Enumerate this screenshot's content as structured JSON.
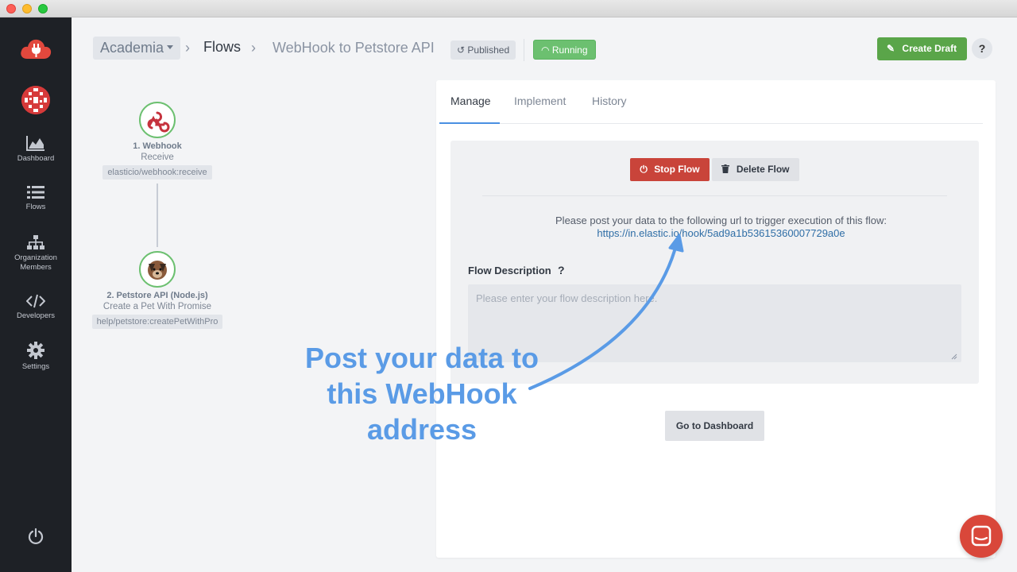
{
  "window": {
    "title": ""
  },
  "sidebar": {
    "items": [
      {
        "label": "Dashboard",
        "icon": "area-chart-icon"
      },
      {
        "label": "Flows",
        "icon": "list-icon"
      },
      {
        "label": "Organization Members",
        "icon": "org-tree-icon"
      },
      {
        "label": "Developers",
        "icon": "code-icon"
      },
      {
        "label": "Settings",
        "icon": "gear-icon"
      }
    ],
    "power_icon": "power-icon"
  },
  "header": {
    "org": "Academia",
    "breadcrumb_flows": "Flows",
    "flow_name": "WebHook to Petstore API",
    "published_label": "Published",
    "running_label": "Running",
    "create_draft_label": "Create Draft",
    "help_label": "?"
  },
  "flow": {
    "steps": [
      {
        "title": "1. Webhook",
        "subtitle": "Receive",
        "tag": "elasticio/webhook:receive"
      },
      {
        "title": "2. Petstore API (Node.js)",
        "subtitle": "Create a Pet With Promise",
        "tag": "help/petstore:createPetWithPro"
      }
    ]
  },
  "panel": {
    "tabs": [
      "Manage",
      "Implement",
      "History"
    ],
    "active_tab": "Manage",
    "stop_label": "Stop Flow",
    "delete_label": "Delete Flow",
    "post_text": "Please post your data to the following url to trigger execution of this flow:",
    "webhook_url": "https://in.elastic.io/hook/5ad9a1b53615360007729a0e",
    "description_label": "Flow Description",
    "description_help": "?",
    "description_placeholder": "Please enter your flow description here.",
    "description_value": "",
    "dashboard_label": "Go to Dashboard"
  },
  "annotation": {
    "lines": [
      "Post your data to",
      "this WebHook",
      "address"
    ]
  },
  "colors": {
    "sidebar_bg": "#1e2126",
    "stop_red": "#c9443a",
    "create_green": "#5aa549",
    "running_green": "#6cc070",
    "annotation_blue": "#5a9be6",
    "link_blue": "#2f6ea6"
  }
}
